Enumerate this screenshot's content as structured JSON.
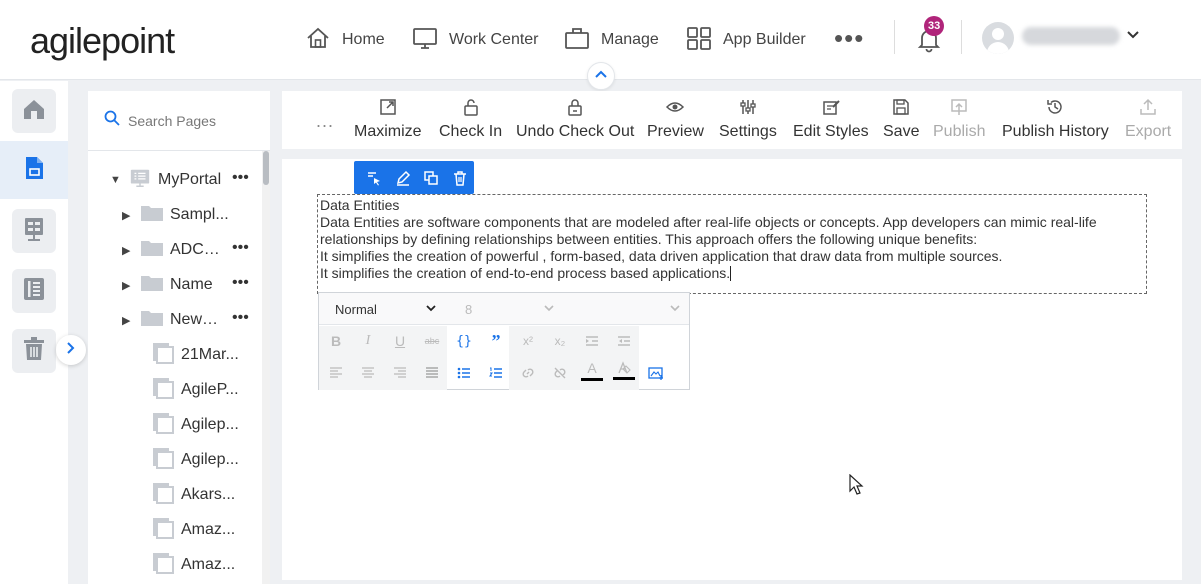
{
  "header": {
    "logo_text": "agilepoint",
    "nav": [
      {
        "label": "Home",
        "icon": "home-icon"
      },
      {
        "label": "Work Center",
        "icon": "monitor-icon"
      },
      {
        "label": "Manage",
        "icon": "briefcase-icon"
      },
      {
        "label": "App Builder",
        "icon": "grid-icon"
      }
    ],
    "more_label": "•••",
    "notification_count": "33",
    "colors": {
      "accent": "#1a73e8",
      "badge": "#b0247a"
    }
  },
  "rail": {
    "items": [
      {
        "name": "home",
        "icon": "home-icon"
      },
      {
        "name": "pages",
        "icon": "page-icon",
        "active": true
      },
      {
        "name": "forms",
        "icon": "form-icon"
      },
      {
        "name": "list",
        "icon": "list-icon"
      },
      {
        "name": "trash",
        "icon": "trash-icon"
      }
    ]
  },
  "tree": {
    "search_placeholder": "Search Pages",
    "root": {
      "label": "MyPortal"
    },
    "folders": [
      {
        "label": "Sampl..."
      },
      {
        "label": "ADCA..."
      },
      {
        "label": "Name"
      },
      {
        "label": "NewF..."
      }
    ],
    "pages": [
      {
        "label": "21Mar..."
      },
      {
        "label": "AgileP..."
      },
      {
        "label": "Agilep..."
      },
      {
        "label": "Agilep..."
      },
      {
        "label": "Akars..."
      },
      {
        "label": "Amaz..."
      },
      {
        "label": "Amaz..."
      }
    ],
    "dots": "•••"
  },
  "toolbar": {
    "more": "...",
    "buttons": [
      {
        "label": "Maximize",
        "disabled": false
      },
      {
        "label": "Check In",
        "disabled": false
      },
      {
        "label": "Undo Check Out",
        "disabled": false
      },
      {
        "label": "Preview",
        "disabled": false
      },
      {
        "label": "Settings",
        "disabled": false
      },
      {
        "label": "Edit Styles",
        "disabled": false
      },
      {
        "label": "Save",
        "disabled": false
      },
      {
        "label": "Publish",
        "disabled": true
      },
      {
        "label": "Publish History",
        "disabled": false
      },
      {
        "label": "Export",
        "disabled": true
      }
    ]
  },
  "content": {
    "lines": [
      "Data Entities",
      "Data Entities are software components that are modeled after real-life objects or concepts. App developers can mimic real-life relationships by defining relationships between entities. This approach offers the following unique benefits:",
      "It simplifies the creation of powerful , form-based, data driven application that draw data from multiple sources.",
      "It simplifies the creation of end-to-end process based applications."
    ]
  },
  "editor": {
    "format_value": "Normal",
    "size_value": "8"
  }
}
